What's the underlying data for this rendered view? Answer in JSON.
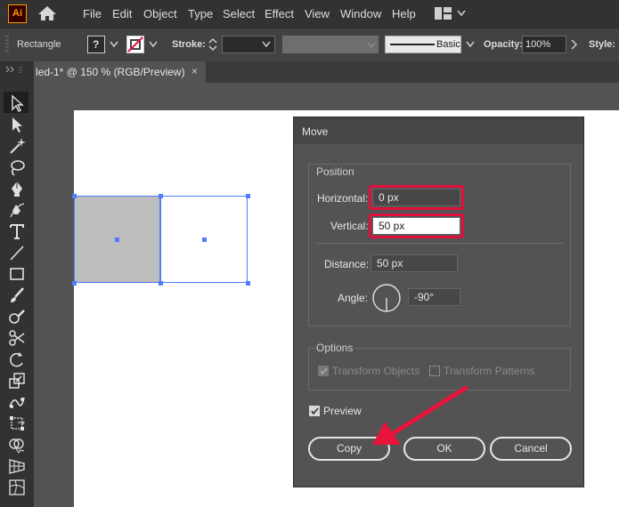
{
  "app": {
    "logo": "Ai"
  },
  "menu": [
    "File",
    "Edit",
    "Object",
    "Type",
    "Select",
    "Effect",
    "View",
    "Window",
    "Help"
  ],
  "control": {
    "tool_name": "Rectangle",
    "stroke_label": "Stroke:",
    "brush_label": "Basic",
    "opacity_label": "Opacity:",
    "opacity_value": "100%",
    "style_label": "Style:"
  },
  "document": {
    "tab_title": "led-1* @ 150 % (RGB/Preview)",
    "close": "×"
  },
  "dialog": {
    "title": "Move",
    "position_label": "Position",
    "horizontal_label": "Horizontal:",
    "horizontal_value": "0 px",
    "vertical_label": "Vertical:",
    "vertical_value": "50 px",
    "distance_label": "Distance:",
    "distance_value": "50 px",
    "angle_label": "Angle:",
    "angle_value": "-90°",
    "options_label": "Options",
    "transform_objects": "Transform Objects",
    "transform_patterns": "Transform Patterns",
    "preview_label": "Preview",
    "copy_button": "Copy",
    "ok_button": "OK",
    "cancel_button": "Cancel"
  },
  "colors": {
    "highlight": "#e0103c",
    "arrow": "#e8143c",
    "selection": "#4f7bff"
  }
}
